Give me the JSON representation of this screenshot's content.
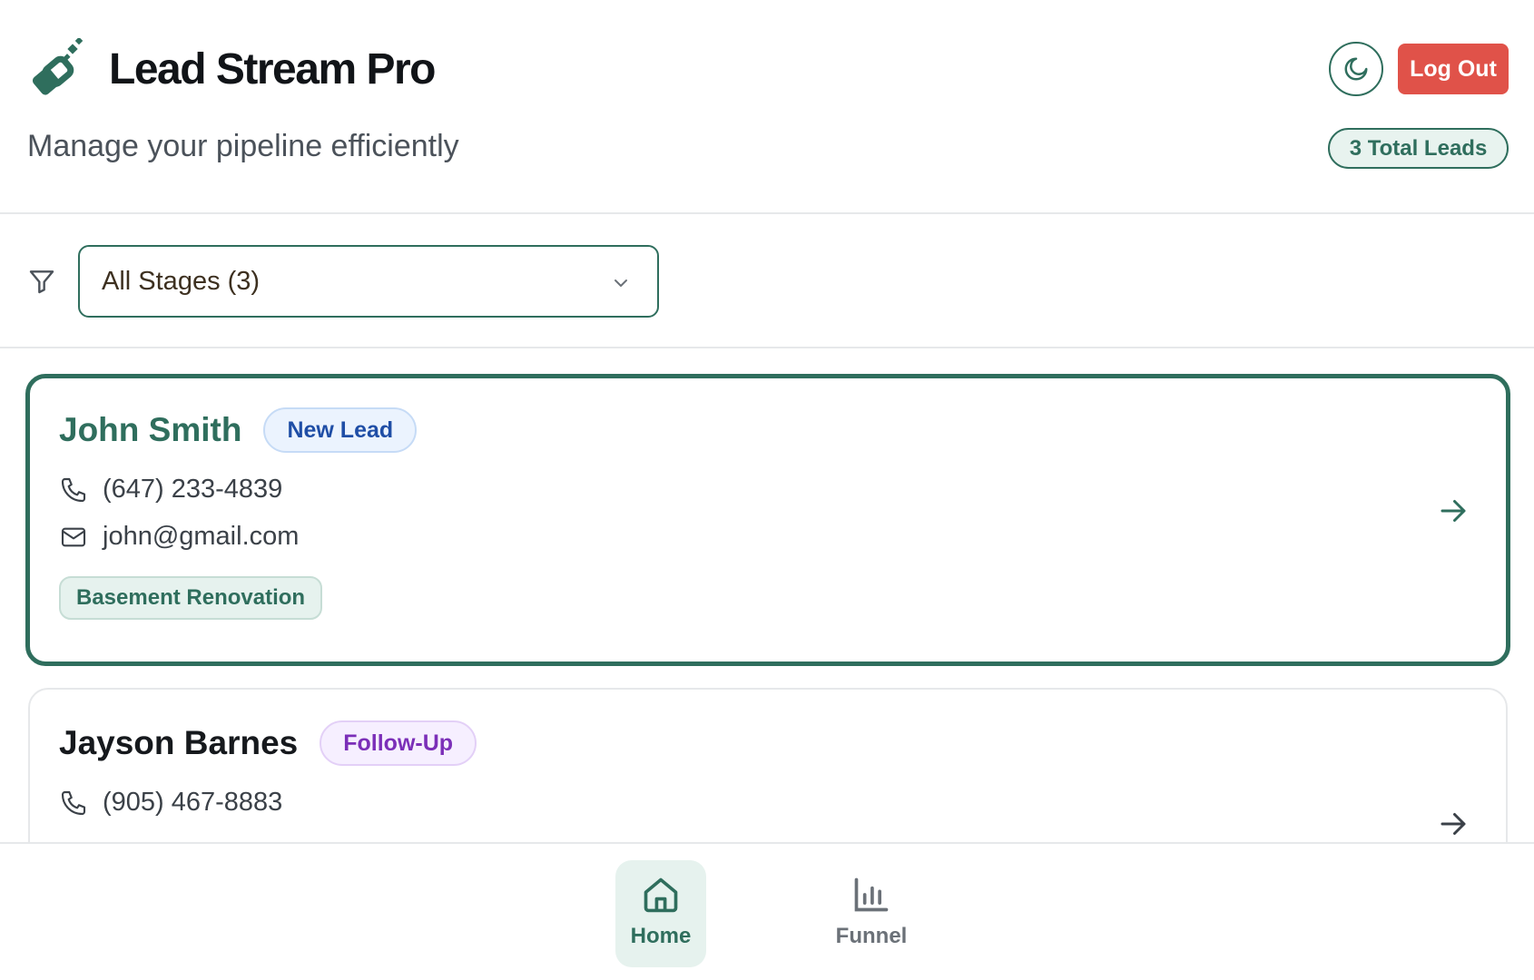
{
  "app": {
    "title": "Lead Stream Pro",
    "subtitle": "Manage your pipeline efficiently",
    "logo_icon": "lead-stream-logo-icon"
  },
  "header": {
    "theme_toggle_icon": "moon-icon",
    "logout_label": "Log Out",
    "total_leads_label": "3 Total Leads"
  },
  "filter": {
    "icon": "filter-icon",
    "selected_value": "All Stages (3)",
    "chevron_icon": "chevron-down-icon"
  },
  "leads": [
    {
      "name": "John Smith",
      "stage": "New Lead",
      "phone": "(647) 233-4839",
      "email": "john@gmail.com",
      "project": "Basement Renovation",
      "selected": true
    },
    {
      "name": "Jayson Barnes",
      "stage": "Follow-Up",
      "phone": "(905) 467-8883",
      "selected": false
    }
  ],
  "nav": {
    "items": [
      {
        "label": "Home",
        "icon": "home-icon",
        "active": true
      },
      {
        "label": "Funnel",
        "icon": "bar-chart-icon",
        "active": false
      }
    ]
  },
  "colors": {
    "primary": "#2f6e5d",
    "danger": "#e05249",
    "new_lead": "#1f4ea6",
    "follow_up": "#7b2fb8"
  }
}
